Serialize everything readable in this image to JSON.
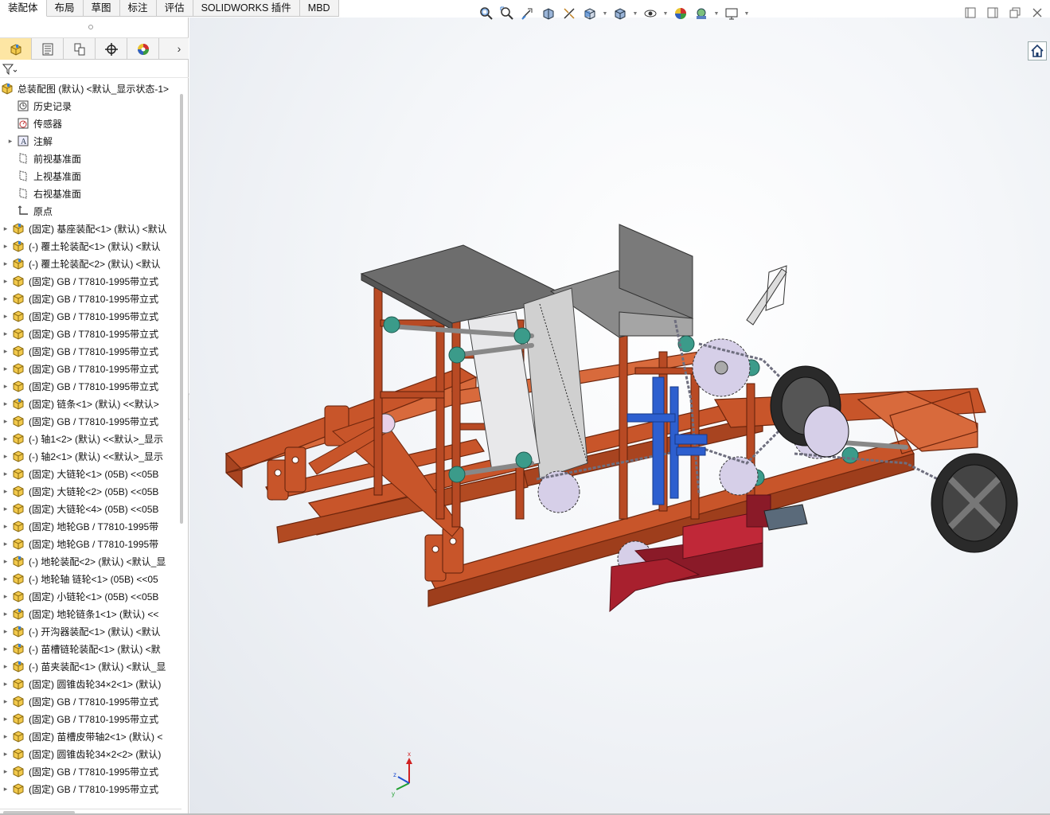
{
  "command_tabs": [
    "装配体",
    "布局",
    "草图",
    "标注",
    "评估",
    "SOLIDWORKS 插件",
    "MBD"
  ],
  "heads_up_icons": [
    "zoom-to-fit-icon",
    "zoom-to-area-icon",
    "previous-view-icon",
    "section-view-icon",
    "dynamic-annotation-icon",
    "view-orientation-icon",
    "display-style-icon",
    "hide-show-items-icon",
    "edit-appearance-icon",
    "apply-scene-icon",
    "view-settings-icon"
  ],
  "panel_tabs": [
    "featuremanager-tab",
    "propertymanager-tab",
    "configurationmanager-tab",
    "dimxpertmanager-tab",
    "displaymanager-tab"
  ],
  "tree": {
    "root": "总装配图 (默认) <默认_显示状态-1>",
    "system_items": [
      {
        "label": "历史记录",
        "icon": "history-icon",
        "expand": false
      },
      {
        "label": "传感器",
        "icon": "sensor-icon",
        "expand": false
      },
      {
        "label": "注解",
        "icon": "annotation-icon",
        "expand": true
      },
      {
        "label": "前视基准面",
        "icon": "plane-icon",
        "expand": false
      },
      {
        "label": "上视基准面",
        "icon": "plane-icon",
        "expand": false
      },
      {
        "label": "右视基准面",
        "icon": "plane-icon",
        "expand": false
      },
      {
        "label": "原点",
        "icon": "origin-icon",
        "expand": false
      }
    ],
    "components": [
      {
        "label": "(固定) 基座装配<1> (默认) <默认",
        "icon": "assembly-icon"
      },
      {
        "label": "(-) 覆土轮装配<1> (默认) <默认",
        "icon": "assembly-icon"
      },
      {
        "label": "(-) 覆土轮装配<2> (默认) <默认",
        "icon": "assembly-icon"
      },
      {
        "label": "(固定) GB / T7810-1995带立式",
        "icon": "part-icon"
      },
      {
        "label": "(固定) GB / T7810-1995带立式",
        "icon": "part-icon"
      },
      {
        "label": "(固定) GB / T7810-1995带立式",
        "icon": "part-icon"
      },
      {
        "label": "(固定) GB / T7810-1995带立式",
        "icon": "part-icon"
      },
      {
        "label": "(固定) GB / T7810-1995带立式",
        "icon": "part-icon"
      },
      {
        "label": "(固定) GB / T7810-1995带立式",
        "icon": "part-icon"
      },
      {
        "label": "(固定) GB / T7810-1995带立式",
        "icon": "part-icon"
      },
      {
        "label": "(固定) 链条<1> (默认) <<默认>",
        "icon": "assembly-icon"
      },
      {
        "label": "(固定) GB / T7810-1995带立式",
        "icon": "part-icon"
      },
      {
        "label": "(-) 轴1<2> (默认) <<默认>_显示",
        "icon": "part-icon"
      },
      {
        "label": "(-) 轴2<1> (默认) <<默认>_显示",
        "icon": "part-icon"
      },
      {
        "label": "(固定) 大链轮<1> (05B) <<05B",
        "icon": "part-icon"
      },
      {
        "label": "(固定) 大链轮<2> (05B) <<05B",
        "icon": "part-icon"
      },
      {
        "label": "(固定) 大链轮<4> (05B) <<05B",
        "icon": "part-icon"
      },
      {
        "label": "(固定) 地轮GB / T7810-1995带",
        "icon": "part-icon"
      },
      {
        "label": "(固定) 地轮GB / T7810-1995带",
        "icon": "part-icon"
      },
      {
        "label": "(-) 地轮装配<2> (默认) <默认_显",
        "icon": "assembly-icon"
      },
      {
        "label": "(-) 地轮轴 链轮<1> (05B) <<05",
        "icon": "part-icon"
      },
      {
        "label": "(固定) 小链轮<1> (05B) <<05B",
        "icon": "part-icon"
      },
      {
        "label": "(固定) 地轮链条1<1> (默认) <<",
        "icon": "assembly-icon"
      },
      {
        "label": "(-) 开沟器装配<1> (默认) <默认",
        "icon": "assembly-icon"
      },
      {
        "label": "(-) 苗槽链轮装配<1> (默认) <默",
        "icon": "assembly-icon"
      },
      {
        "label": "(-) 苗夹装配<1> (默认) <默认_显",
        "icon": "assembly-icon"
      },
      {
        "label": "(固定) 圆锥齿轮34×2<1> (默认)",
        "icon": "part-icon"
      },
      {
        "label": "(固定) GB / T7810-1995带立式",
        "icon": "part-icon"
      },
      {
        "label": "(固定) GB / T7810-1995带立式",
        "icon": "part-icon"
      },
      {
        "label": "(固定) 苗槽皮带轴2<1> (默认) <",
        "icon": "part-icon"
      },
      {
        "label": "(固定) 圆锥齿轮34×2<2> (默认)",
        "icon": "part-icon"
      },
      {
        "label": "(固定) GB / T7810-1995带立式",
        "icon": "part-icon"
      },
      {
        "label": "(固定) GB / T7810-1995带立式",
        "icon": "part-icon"
      }
    ]
  },
  "triad_axes": {
    "x": "x",
    "y": "y",
    "z": "z"
  },
  "colors": {
    "frame": "#c8552a",
    "frame_dark": "#7a2a10",
    "seat": "#707070",
    "wheel": "#2a2a2a",
    "bearing": "#3b9b8a",
    "chain": "#8a8a9a",
    "furrow": "#a8202e",
    "accent_blue": "#2d5fcf",
    "tab_active": "#fde6a4"
  }
}
